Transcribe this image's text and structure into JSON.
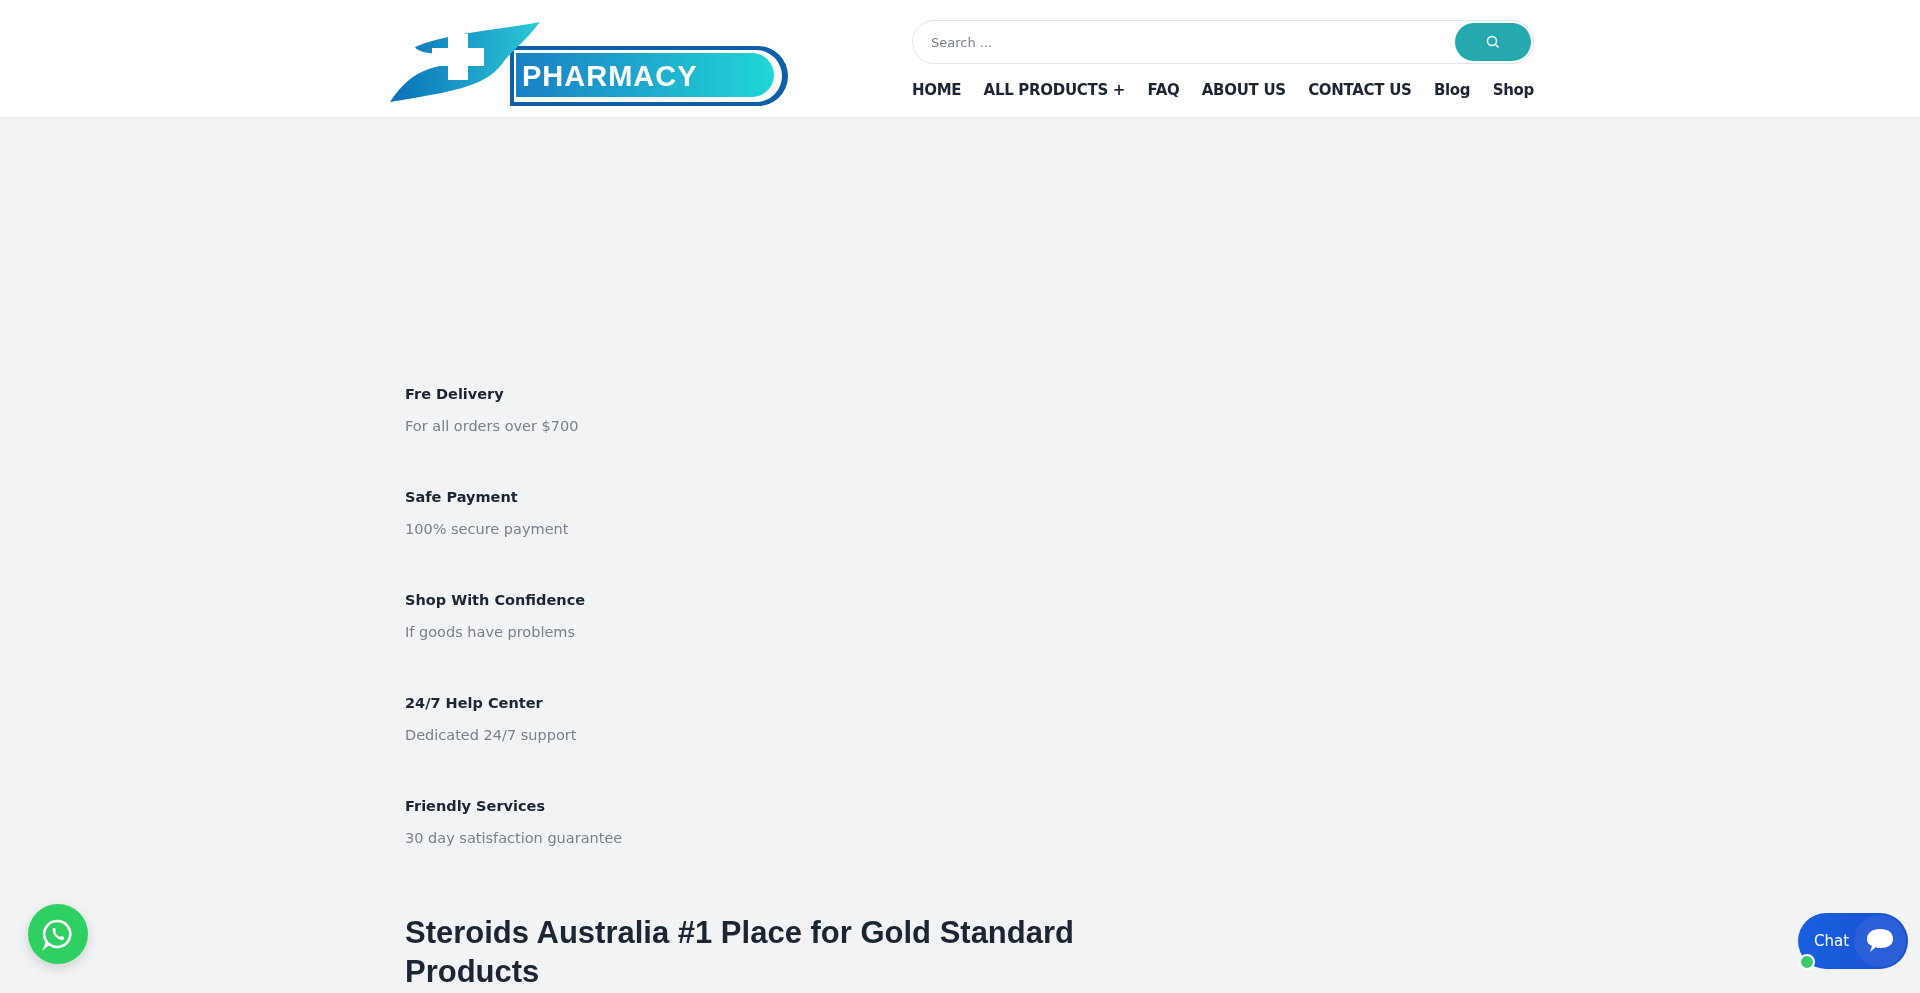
{
  "logo": {
    "text": "PHARMACY"
  },
  "search": {
    "placeholder": "Search ..."
  },
  "nav": [
    {
      "label": "HOME",
      "has_submenu": false
    },
    {
      "label": "ALL PRODUCTS",
      "has_submenu": true
    },
    {
      "label": "FAQ",
      "has_submenu": false
    },
    {
      "label": "ABOUT US",
      "has_submenu": false
    },
    {
      "label": "CONTACT US",
      "has_submenu": false
    },
    {
      "label": "Blog",
      "has_submenu": false
    },
    {
      "label": "Shop",
      "has_submenu": false
    }
  ],
  "submenu_mark": "+",
  "features": [
    {
      "title": "Fre Delivery",
      "text": "For all orders over $700"
    },
    {
      "title": "Safe Payment",
      "text": "100% secure payment"
    },
    {
      "title": "Shop With Confidence",
      "text": "If goods have problems"
    },
    {
      "title": "24/7 Help Center",
      "text": "Dedicated 24/7 support"
    },
    {
      "title": "Friendly Services",
      "text": "30 day satisfaction guarantee"
    }
  ],
  "heading": "Steroids Australia #1 Place for Gold Standard Products",
  "chat": {
    "label": "Chat",
    "online": true
  }
}
